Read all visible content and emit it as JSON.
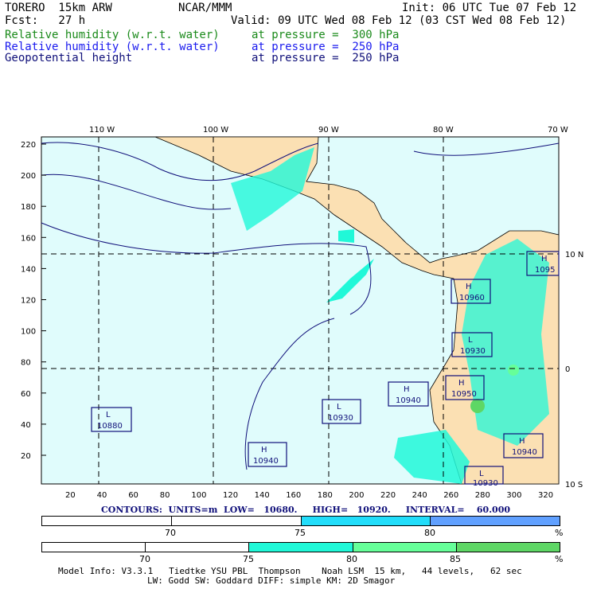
{
  "header": {
    "model": "TORERO  15km ARW",
    "org": "NCAR/MMM",
    "init": "Init: 06 UTC Tue 07 Feb 12",
    "fcst": "Fcst:   27 h",
    "valid": "Valid: 09 UTC Wed 08 Feb 12 (03 CST Wed 08 Feb 12)"
  },
  "fields": [
    {
      "name": "Relative humidity (w.r.t. water)",
      "level": "at pressure =  300 hPa",
      "color": "#1a8a1a"
    },
    {
      "name": "Relative humidity (w.r.t. water)",
      "level": "at pressure =  250 hPa",
      "color": "#1a1aee"
    },
    {
      "name": "Geopotential height",
      "level": "at pressure =  250 hPa",
      "color": "#10107a"
    }
  ],
  "map": {
    "lon_labels": [
      "110 W",
      "100 W",
      "90 W",
      "80 W",
      "70 W"
    ],
    "lat_labels": [
      "10 N",
      "0",
      "10 S"
    ],
    "x_ticks": [
      "20",
      "40",
      "60",
      "80",
      "100",
      "120",
      "140",
      "160",
      "180",
      "200",
      "220",
      "240",
      "260",
      "280",
      "300",
      "320"
    ],
    "y_ticks": [
      "220",
      "200",
      "180",
      "160",
      "140",
      "120",
      "100",
      "80",
      "60",
      "40",
      "20"
    ],
    "centers": [
      {
        "type": "L",
        "value": "10880"
      },
      {
        "type": "H",
        "value": "10940"
      },
      {
        "type": "L",
        "value": "10930"
      },
      {
        "type": "H",
        "value": "10940"
      },
      {
        "type": "H",
        "value": "10950"
      },
      {
        "type": "L",
        "value": "10930"
      },
      {
        "type": "H",
        "value": "10960"
      },
      {
        "type": "H",
        "value": "1095"
      },
      {
        "type": "H",
        "value": "10940"
      },
      {
        "type": "L",
        "value": "10930"
      }
    ]
  },
  "contours": "CONTOURS:  UNITS=m  LOW=   10680.     HIGH=   10920.     INTERVAL=    60.000",
  "bar1": {
    "labels": [
      "70",
      "75",
      "80",
      "%"
    ],
    "colors": [
      "#ffffff",
      "#ffffff",
      "#22ddfa",
      "#60a0ff"
    ]
  },
  "bar2": {
    "labels": [
      "70",
      "75",
      "80",
      "85",
      "%"
    ],
    "colors": [
      "#ffffff",
      "#ffffff",
      "#20f8d8",
      "#66ff99",
      "#5ed765"
    ]
  },
  "footer": {
    "line1": "Model Info: V3.3.1   Tiedtke YSU PBL  Thompson    Noah LSM  15 km,   44 levels,   62 sec",
    "line2": "LW: Godd SW: Goddard DIFF: simple KM: 2D Smagor"
  }
}
